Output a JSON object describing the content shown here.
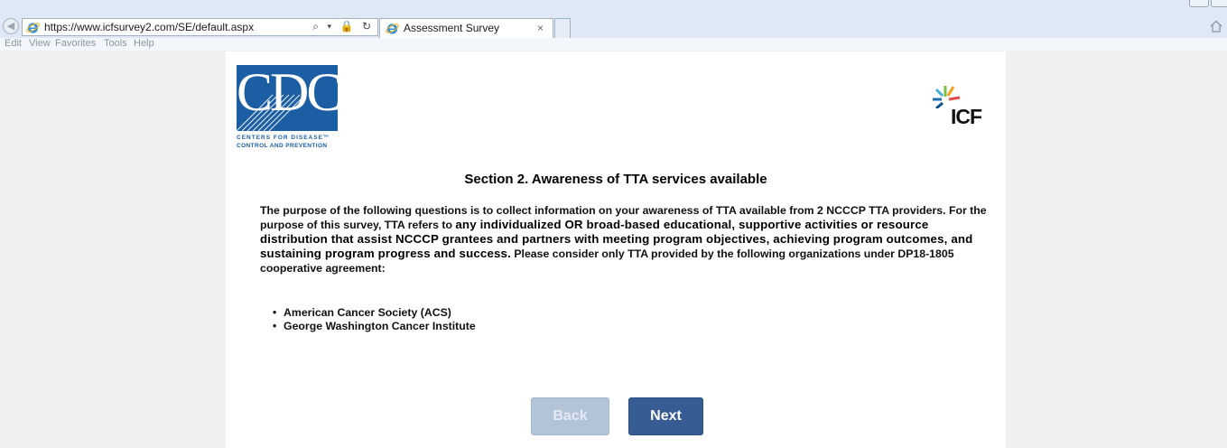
{
  "browser": {
    "url": "https://www.icfsurvey2.com/SE/default.aspx",
    "tab_title": "Assessment Survey",
    "tab_close": "×",
    "address_tools": "⌕ ▾ 🔒 ↻",
    "menu": [
      "Edit",
      "View",
      "Favorites",
      "Tools",
      "Help"
    ]
  },
  "logos": {
    "cdc_mark": "CDC",
    "cdc_line1": "CENTERS FOR DISEASE™",
    "cdc_line2": "CONTROL AND PREVENTION",
    "icf": "ICF"
  },
  "section": {
    "title": "Section 2. Awareness of TTA services available",
    "intro_part1": "The purpose of the following questions is to collect information on your awareness of TTA available from 2 NCCCP TTA providers. For the purpose of this survey, TTA refers to ",
    "intro_emphasis": "any individualized OR broad-based educational, supportive activities or resource distribution that assist NCCCP grantees and partners with meeting program objectives, achieving program outcomes, and sustaining program progress and success.",
    "intro_part2": " Please consider only TTA provided by the following organizations under DP18-1805 cooperative agreement:",
    "organizations": [
      "American Cancer Society (ACS)",
      "George Washington Cancer Institute"
    ]
  },
  "nav": {
    "back_label": "Back",
    "next_label": "Next"
  },
  "colors": {
    "cdc_blue": "#1b5ea3",
    "next_button": "#375c94",
    "back_button_disabled": "#b4c4d8"
  }
}
